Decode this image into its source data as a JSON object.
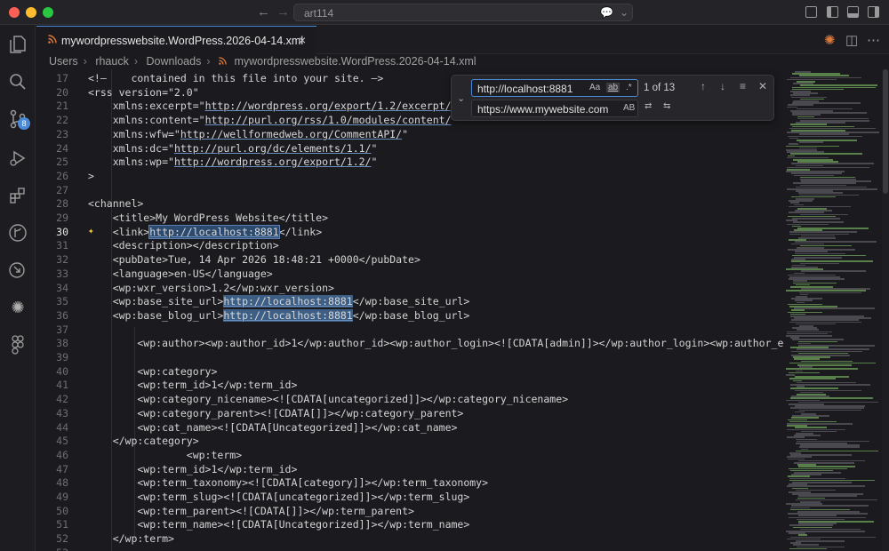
{
  "window": {
    "title": "art114"
  },
  "tab": {
    "label": "mywordpresswebsite.WordPress.2026-04-14.xml",
    "close": "×"
  },
  "breadcrumb": [
    "Users",
    "rhauck",
    "Downloads",
    "mywordpresswebsite.WordPress.2026-04-14.xml"
  ],
  "find": {
    "find_value": "http://localhost:8881",
    "replace_value": "https://www.mywebsite.com",
    "count": "1 of 13",
    "opt_case": "Aa",
    "opt_word": "ab",
    "opt_regex": ".*",
    "opt_preserve": "AB"
  },
  "source_control_badge": "8",
  "colors": {
    "accent": "#4a8ad8",
    "highlight": "#3d5f86",
    "rss": "#e07a3a"
  },
  "lines": [
    {
      "n": "17",
      "text": "<!—    contained in this file into your site. —>"
    },
    {
      "n": "20",
      "text": "<rss version=\"2.0\""
    },
    {
      "n": "21",
      "text": "    xmlns:excerpt=\"http://wordpress.org/export/1.2/excerpt/\""
    },
    {
      "n": "22",
      "text": "    xmlns:content=\"http://purl.org/rss/1.0/modules/content/\""
    },
    {
      "n": "23",
      "text": "    xmlns:wfw=\"http://wellformedweb.org/CommentAPI/\""
    },
    {
      "n": "24",
      "text": "    xmlns:dc=\"http://purl.org/dc/elements/1.1/\""
    },
    {
      "n": "25",
      "text": "    xmlns:wp=\"http://wordpress.org/export/1.2/\""
    },
    {
      "n": "26",
      "text": ">"
    },
    {
      "n": "27",
      "text": ""
    },
    {
      "n": "28",
      "text": "<channel>"
    },
    {
      "n": "29",
      "text": "    <title>My WordPress Website</title>"
    },
    {
      "n": "30",
      "text": "    <link>http://localhost:8881</link>"
    },
    {
      "n": "31",
      "text": "    <description></description>"
    },
    {
      "n": "32",
      "text": "    <pubDate>Tue, 14 Apr 2026 18:48:21 +0000</pubDate>"
    },
    {
      "n": "33",
      "text": "    <language>en-US</language>"
    },
    {
      "n": "34",
      "text": "    <wp:wxr_version>1.2</wp:wxr_version>"
    },
    {
      "n": "35",
      "text": "    <wp:base_site_url>http://localhost:8881</wp:base_site_url>"
    },
    {
      "n": "36",
      "text": "    <wp:base_blog_url>http://localhost:8881</wp:base_blog_url>"
    },
    {
      "n": "37",
      "text": ""
    },
    {
      "n": "38",
      "text": "        <wp:author><wp:author_id>1</wp:author_id><wp:author_login><![CDATA[admin]]></wp:author_login><wp:author_email><![C"
    },
    {
      "n": "39",
      "text": ""
    },
    {
      "n": "40",
      "text": "        <wp:category>"
    },
    {
      "n": "41",
      "text": "        <wp:term_id>1</wp:term_id>"
    },
    {
      "n": "42",
      "text": "        <wp:category_nicename><![CDATA[uncategorized]]></wp:category_nicename>"
    },
    {
      "n": "43",
      "text": "        <wp:category_parent><![CDATA[]]></wp:category_parent>"
    },
    {
      "n": "44",
      "text": "        <wp:cat_name><![CDATA[Uncategorized]]></wp:cat_name>"
    },
    {
      "n": "45",
      "text": "    </wp:category>"
    },
    {
      "n": "46",
      "text": "                <wp:term>"
    },
    {
      "n": "47",
      "text": "        <wp:term_id>1</wp:term_id>"
    },
    {
      "n": "48",
      "text": "        <wp:term_taxonomy><![CDATA[category]]></wp:term_taxonomy>"
    },
    {
      "n": "49",
      "text": "        <wp:term_slug><![CDATA[uncategorized]]></wp:term_slug>"
    },
    {
      "n": "50",
      "text": "        <wp:term_parent><![CDATA[]]></wp:term_parent>"
    },
    {
      "n": "51",
      "text": "        <wp:term_name><![CDATA[Uncategorized]]></wp:term_name>"
    },
    {
      "n": "52",
      "text": "    </wp:term>"
    },
    {
      "n": "53",
      "text": ""
    }
  ]
}
